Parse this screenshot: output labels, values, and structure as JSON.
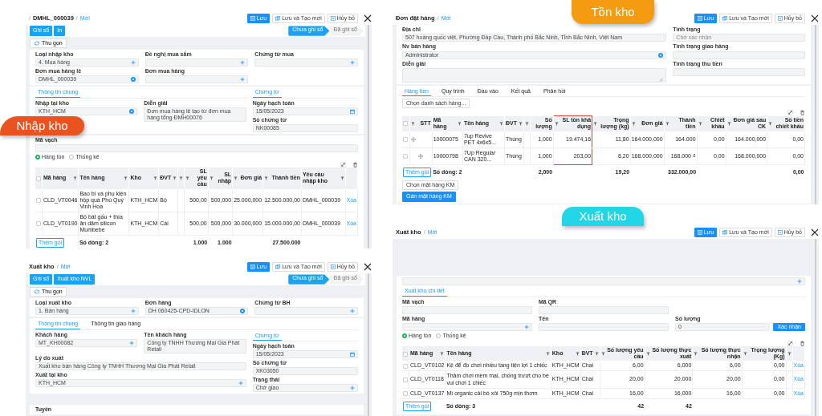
{
  "badges": [
    {
      "label": "Nhập kho",
      "color": "#e9531f"
    },
    {
      "label": "Tồn kho",
      "color": "#f59b12"
    },
    {
      "label": "Xuất kho",
      "color": "#22d6e8"
    }
  ],
  "panels": [
    {
      "breadcrumb": [
        {
          "kind": "sep",
          "label": "/"
        },
        {
          "kind": "title",
          "label": "DMHL_000039"
        },
        {
          "kind": "sep",
          "label": "/"
        },
        {
          "kind": "link",
          "label": "Mới"
        }
      ],
      "buttons": [
        {
          "label": "Lưu",
          "primary": true
        },
        {
          "label": "Lưu và Tạo mới",
          "primary": false
        },
        {
          "label": "Hủy bỏ",
          "primary": false
        }
      ],
      "blocks": [
        {
          "kind": "actions",
          "buttons": [
            "Ghi sổ",
            "In"
          ],
          "steps": [
            {
              "label": "Chưa ghi sổ",
              "selected": true
            },
            {
              "label": "Đã ghi sổ",
              "selected": false
            }
          ]
        },
        {
          "kind": "collapse",
          "label": "Thu gọn"
        },
        {
          "kind": "card",
          "parts": [
            {
              "kind": "form",
              "rows": [
                [
                  {
                    "label": "Loại nhập kho",
                    "value": "4. Mua hàng",
                    "kind": "lookup"
                  },
                  {
                    "label": "Đề nghị mua sắm",
                    "kind": "lookup"
                  },
                  {
                    "label": "Chứng từ mua",
                    "kind": "lookup"
                  }
                ],
                [
                  {
                    "label": "Đơn mua hàng lẻ",
                    "value": "DMHL_000039",
                    "kind": "picked"
                  },
                  {
                    "label": "Đơn mua hàng",
                    "kind": "lookup"
                  }
                ]
              ]
            }
          ]
        },
        {
          "kind": "card",
          "parts": [
            {
              "kind": "form",
              "tabs": [
                {
                  "label": "Thông tin chung",
                  "selected": true
                }
              ],
              "rows": [
                [
                  {
                    "label": "Nhập tại kho",
                    "value": "KTH_HCM",
                    "kind": "picked"
                  },
                  {
                    "label": "Diễn giải",
                    "value": "Đơn mua hàng lẻ tạo từ đơn mua hàng tổng ĐMH00076",
                    "kind": "text"
                  }
                ]
              ],
              "side": {
                "tabs": [
                  {
                    "label": "Chứng từ",
                    "selected": true
                  }
                ],
                "fields": [
                  {
                    "label": "Ngày hạch toán",
                    "value": "15/05/2023",
                    "kind": "date"
                  },
                  {
                    "label": "Số chứng từ",
                    "value": "NK00085",
                    "kind": "text"
                  }
                ]
              }
            }
          ]
        },
        {
          "kind": "card",
          "parts": [
            {
              "kind": "form",
              "rows": [
                [
                  {
                    "label": "Mã vạch",
                    "kind": "text"
                  }
                ]
              ]
            },
            {
              "kind": "radios",
              "options": [
                {
                  "label": "Hàng tồn",
                  "selected": true
                },
                {
                  "label": "Thống kê",
                  "selected": false
                }
              ]
            },
            {
              "kind": "table",
              "columns": [
                {
                  "label": "Mã hàng",
                  "filter": true,
                  "numeric": false
                },
                {
                  "label": "Tên hàng",
                  "filter": true,
                  "numeric": false
                },
                {
                  "label": "Kho",
                  "filter": true,
                  "numeric": false
                },
                {
                  "label": "ĐVT",
                  "filter": true,
                  "numeric": false
                },
                {
                  "filter": true,
                  "numeric": true
                },
                {
                  "label": "SL yêu cầu",
                  "filter": true,
                  "numeric": true
                },
                {
                  "label": "SL nhập",
                  "filter": true,
                  "numeric": true
                },
                {
                  "label": "Đơn giá",
                  "filter": true,
                  "numeric": true
                },
                {
                  "label": "Thành tiền",
                  "filter": true,
                  "numeric": true
                },
                {
                  "label": "Yêu cầu nhập kho",
                  "filter": true,
                  "numeric": false
                }
              ],
              "all_checked": false,
              "rows": [
                {
                  "checked": false,
                  "cells": [
                    "CLD_VT0046",
                    "Bao bì và phụ kiện hộp quà Phú Quý Vinh Hoa",
                    "KTH_HCM",
                    "Bộ",
                    null,
                    "500,00",
                    "500,000",
                    "25.000,000",
                    "12.500.000,00",
                    "DMHL_000039"
                  ],
                  "action": "Xóa"
                },
                {
                  "checked": false,
                  "cells": [
                    "CLD_VT0190",
                    "Bộ bát gấu + thìa ăn dặm silicon Mumbebe",
                    "KTH_HCM",
                    "Cái",
                    null,
                    "500,00",
                    "500,000",
                    "30.000,000",
                    "15.000.000,00",
                    "DMHL_000039"
                  ],
                  "action": "Xóa"
                }
              ],
              "footer": {
                "add": "Thêm gói",
                "cells": [
                  null,
                  "Số dòng: 2",
                  null,
                  null,
                  null,
                  "1.000",
                  "1.000",
                  null,
                  "27.500.000",
                  null
                ]
              }
            }
          ]
        }
      ]
    },
    {
      "breadcrumb": [
        {
          "kind": "title",
          "label": "Xuất kho"
        },
        {
          "kind": "sep",
          "label": "/"
        },
        {
          "kind": "link",
          "label": "Mới"
        }
      ],
      "buttons": [
        {
          "label": "Lưu",
          "primary": true
        },
        {
          "label": "Lưu và Tạo mới",
          "primary": false
        },
        {
          "label": "Hủy bỏ",
          "primary": false
        }
      ],
      "blocks": [
        {
          "kind": "actions",
          "buttons": [
            "Ghi sổ",
            "Xuất kho NVL"
          ],
          "steps": [
            {
              "label": "Chưa ghi sổ",
              "selected": true
            },
            {
              "label": "Đã ghi sổ",
              "selected": false
            }
          ]
        },
        {
          "kind": "collapse",
          "label": "Thu gọn"
        },
        {
          "kind": "card",
          "parts": [
            {
              "kind": "form",
              "rows": [
                [
                  {
                    "label": "Loại xuất kho",
                    "value": "1. Bán hàng",
                    "kind": "lookup"
                  },
                  {
                    "label": "Đơn hàng",
                    "value": "DH 060425-CPD-IDLON",
                    "kind": "picked"
                  },
                  {
                    "label": "Chứng từ BH",
                    "kind": "lookup"
                  }
                ]
              ]
            }
          ]
        },
        {
          "kind": "card",
          "parts": [
            {
              "kind": "tabs",
              "tabs": [
                {
                  "label": "Thông tin chung",
                  "selected": true
                },
                {
                  "label": "Thông tin giao hàng",
                  "selected": false
                }
              ]
            },
            {
              "kind": "form",
              "rows": [
                [
                  {
                    "label": "Khách hàng",
                    "value": "MT_KH00082",
                    "kind": "lookup"
                  },
                  {
                    "label": "Tên khách hàng",
                    "value": "Công ty TNHH Thương Mại Gia Phát Retail",
                    "kind": "text"
                  }
                ],
                [
                  {
                    "label": "Lý do xuất",
                    "value": "Xuất kho bán hàng Công ty TNHH Thương Mại Gia Phát Retail",
                    "kind": "text"
                  }
                ],
                [
                  {
                    "label": "Xuất tại kho",
                    "value": "KTH_HCM",
                    "kind": "lookup"
                  }
                ]
              ],
              "side": {
                "tabs": [
                  {
                    "label": "Chứng từ",
                    "selected": true
                  }
                ],
                "fields": [
                  {
                    "label": "Ngày hạch toán",
                    "value": "15/05/2023",
                    "kind": "date"
                  },
                  {
                    "label": "Số chứng từ",
                    "value": "XK03050",
                    "kind": "text"
                  },
                  {
                    "label": "Trạng thái",
                    "value": "Chờ giao",
                    "kind": "lookup"
                  }
                ]
              }
            }
          ]
        },
        {
          "kind": "card",
          "parts": [
            {
              "kind": "heading",
              "label": "Tuyến"
            }
          ]
        }
      ]
    },
    {
      "breadcrumb": [
        {
          "kind": "title",
          "label": "Đơn đặt hàng"
        },
        {
          "kind": "sep",
          "label": "/"
        },
        {
          "kind": "link",
          "label": "Mới"
        }
      ],
      "buttons": [
        {
          "label": "Lưu",
          "primary": true
        },
        {
          "label": "Lưu và Tạo mới",
          "primary": false
        },
        {
          "label": "Hủy bỏ",
          "primary": false
        }
      ],
      "blocks": [
        {
          "kind": "card",
          "parts": [
            {
              "kind": "form",
              "rows": [
                [
                  {
                    "label": "Địa chỉ",
                    "value": "507 hoàng quốc việt, Phường Đáp Cầu, Thành phố Bắc Ninh, Tỉnh Bắc Ninh, Việt Nam",
                    "kind": "text"
                  }
                ],
                [
                  {
                    "label": "Nv bán hàng",
                    "value": "Administrator",
                    "kind": "picked"
                  }
                ],
                [
                  {
                    "label": "Diễn giải",
                    "kind": "textarea"
                  }
                ]
              ],
              "side": {
                "fields": [
                  {
                    "label": "Tình trạng",
                    "placeholder": "Chờ xác nhận",
                    "kind": "text"
                  },
                  {
                    "label": "Tình trạng giao hàng",
                    "kind": "text"
                  },
                  {
                    "label": "Tình trạng thu tiền",
                    "kind": "text"
                  }
                ]
              }
            }
          ]
        },
        {
          "kind": "card",
          "parts": [
            {
              "kind": "tabs",
              "tabs": [
                {
                  "label": "Hàng tiền",
                  "selected": true
                },
                {
                  "label": "Quy trình",
                  "selected": false
                },
                {
                  "label": "Đầu vào",
                  "selected": false
                },
                {
                  "label": "Kết quả",
                  "selected": false
                },
                {
                  "label": "Phản hồi",
                  "selected": false
                }
              ]
            },
            {
              "kind": "buttons",
              "buttons": [
                {
                  "label": "Chọn danh sách hàng...",
                  "primary": false
                }
              ]
            },
            {
              "kind": "table",
              "columns": [
                {
                  "label": "STT",
                  "filter": true,
                  "numeric": true,
                  "kind": "handle"
                },
                {
                  "label": "Mã hàng",
                  "filter": true,
                  "numeric": false
                },
                {
                  "label": "Tên hàng",
                  "filter": true,
                  "numeric": false
                },
                {
                  "label": "ĐVT",
                  "filter": true,
                  "numeric": false
                },
                {
                  "filter": true,
                  "numeric": true
                },
                {
                  "label": "Số lượng",
                  "filter": false,
                  "numeric": true
                },
                {
                  "label": "SL tồn khả dụng",
                  "filter": true,
                  "numeric": true,
                  "highlighted": true
                },
                {
                  "label": "Trọng lượng (kg)",
                  "filter": true,
                  "numeric": true
                },
                {
                  "label": "Đơn giá",
                  "filter": true,
                  "numeric": true
                },
                {
                  "label": "Thành tiền",
                  "filter": true,
                  "numeric": true
                },
                {
                  "label": "Chiết khấu",
                  "filter": true,
                  "numeric": true
                },
                {
                  "label": "Đơn giá sau CK",
                  "filter": true,
                  "numeric": true
                },
                {
                  "label": "Số tiền chiết khấu",
                  "filter": true,
                  "numeric": true
                }
              ],
              "all_checked": false,
              "rows": [
                {
                  "checked": false,
                  "cells": [
                    null,
                    "10000075",
                    "7up Revive PET 4x6x5...",
                    "Thùng",
                    null,
                    "1,000",
                    "19.474,16",
                    "11,80",
                    "164.000,000",
                    "164.000",
                    "0,00",
                    "164.000,000",
                    "0,00"
                  ]
                },
                {
                  "checked": false,
                  "cells": [
                    null,
                    "10000798",
                    "7Up Regular CAN 320...",
                    "Thùng",
                    null,
                    "1,000",
                    "203,00",
                    "8,20",
                    "168.000,000",
                    "168.000 ₫",
                    "0,00",
                    "168.000,000",
                    "0,00"
                  ]
                }
              ],
              "footer": {
                "add": "Thêm gói",
                "cells": [
                  null,
                  "Số dòng: 2",
                  null,
                  null,
                  null,
                  "2,000",
                  null,
                  "19,20",
                  null,
                  "332.000,00",
                  null,
                  null,
                  "0,00"
                ]
              }
            },
            {
              "kind": "buttons",
              "buttons": [
                {
                  "label": "Chọn mặt hàng KM",
                  "primary": false
                }
              ]
            },
            {
              "kind": "buttons",
              "buttons": [
                {
                  "label": "Gán mặt hàng KM",
                  "primary": true
                }
              ]
            }
          ]
        }
      ]
    },
    {
      "breadcrumb": [
        {
          "kind": "title",
          "label": "Xuất kho"
        },
        {
          "kind": "sep",
          "label": "/"
        },
        {
          "kind": "link",
          "label": "Mới"
        }
      ],
      "buttons": [
        {
          "label": "Lưu",
          "primary": true
        },
        {
          "label": "Lưu và Tạo mới",
          "primary": false
        },
        {
          "label": "Hủy bỏ",
          "primary": false
        }
      ],
      "blocks": [
        {
          "kind": "card",
          "parts": [
            {
              "kind": "form",
              "rows": [
                [
                  {
                    "kind": "lookup"
                  }
                ]
              ]
            },
            {
              "kind": "tabs",
              "tabs": [
                {
                  "label": "Xuất kho chi tiết",
                  "selected": true
                }
              ]
            },
            {
              "kind": "form",
              "rows": [
                [
                  {
                    "label": "Mã vạch",
                    "kind": "text"
                  },
                  {
                    "label": "Mã QR",
                    "kind": "text"
                  }
                ],
                [
                  {
                    "label": "Mã hàng",
                    "kind": "lookup"
                  },
                  {
                    "label": "Tên",
                    "kind": "text"
                  },
                  {
                    "label": "Số lượng",
                    "value": "0",
                    "kind": "text",
                    "button": "Xác nhận"
                  }
                ]
              ]
            },
            {
              "kind": "radios",
              "options": [
                {
                  "label": "Hàng tồn",
                  "selected": true
                },
                {
                  "label": "Thống kê",
                  "selected": false
                }
              ]
            },
            {
              "kind": "table",
              "columns": [
                {
                  "label": "Mã hàng",
                  "filter": true,
                  "numeric": false
                },
                {
                  "label": "Tên hàng",
                  "filter": true,
                  "numeric": false
                },
                {
                  "label": "Kho",
                  "filter": true,
                  "numeric": false
                },
                {
                  "label": "ĐVT",
                  "filter": true,
                  "numeric": false
                },
                {
                  "label": "Số lượng yêu cầu",
                  "filter": true,
                  "numeric": true
                },
                {
                  "label": "Số lượng thực xuất",
                  "filter": true,
                  "numeric": true
                },
                {
                  "label": "Số lượng thực nhận",
                  "filter": true,
                  "numeric": true
                },
                {
                  "label": "Trọng lượng (Kg)",
                  "filter": true,
                  "numeric": true
                },
                {
                  "filter": true,
                  "numeric": false
                }
              ],
              "all_checked": false,
              "rows": [
                {
                  "checked": false,
                  "cells": [
                    "CLD_VT0102",
                    "Kệ để đồ chơi nhiều tầng tiện lợi 1 chiếc",
                    "KTH_HCM",
                    "Chai",
                    "6,00",
                    "6,000",
                    "6,00",
                    "0,00",
                    null
                  ],
                  "action": "Xóa"
                },
                {
                  "checked": false,
                  "cells": [
                    "CLD_VT0118",
                    "Thảm chơi mềm mại, chống trượt cho bé vui chơi 1 chiếc",
                    "KTH_HCM",
                    "Chai",
                    "20,00",
                    "20,000",
                    "20,00",
                    "0,00",
                    null
                  ],
                  "action": "Xóa"
                },
                {
                  "checked": false,
                  "cells": [
                    "CLD_VT0137",
                    "Mì organic cải bó xôi 750g mịn thơm",
                    "KTH_HCM",
                    "Chai",
                    "16,00",
                    "16,000",
                    "16,00",
                    "0,00",
                    null
                  ],
                  "action": "Xóa"
                }
              ],
              "footer": {
                "add": "Thêm gói",
                "cells": [
                  null,
                  "Số dòng: 3",
                  null,
                  null,
                  "42",
                  "42",
                  null,
                  null,
                  null
                ]
              }
            }
          ]
        }
      ]
    }
  ]
}
